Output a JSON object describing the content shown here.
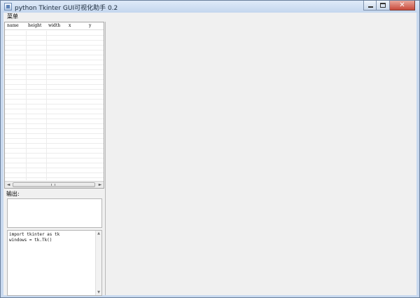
{
  "window": {
    "title": "python Tkinter GUI可视化助手 0.2",
    "close_label": "✕"
  },
  "menu": {
    "items": [
      "菜单"
    ]
  },
  "widget_table": {
    "columns": [
      "name",
      "height",
      "width",
      "x",
      "y"
    ],
    "rows": []
  },
  "scrollbar": {
    "left_arrow": "◄",
    "right_arrow": "►",
    "up_arrow": "▲",
    "down_arrow": "▼"
  },
  "output": {
    "label": "输出:",
    "text": ""
  },
  "code_editor": {
    "lines": [
      "import tkinter as tk",
      "windows = tk.Tk()"
    ]
  },
  "colors": {
    "client_background": "#f0f0f0",
    "titlebar": "#c8d9ef",
    "close_button": "#c8493a"
  },
  "icons": [
    "app-icon",
    "minimize-icon",
    "maximize-icon",
    "close-icon"
  ]
}
